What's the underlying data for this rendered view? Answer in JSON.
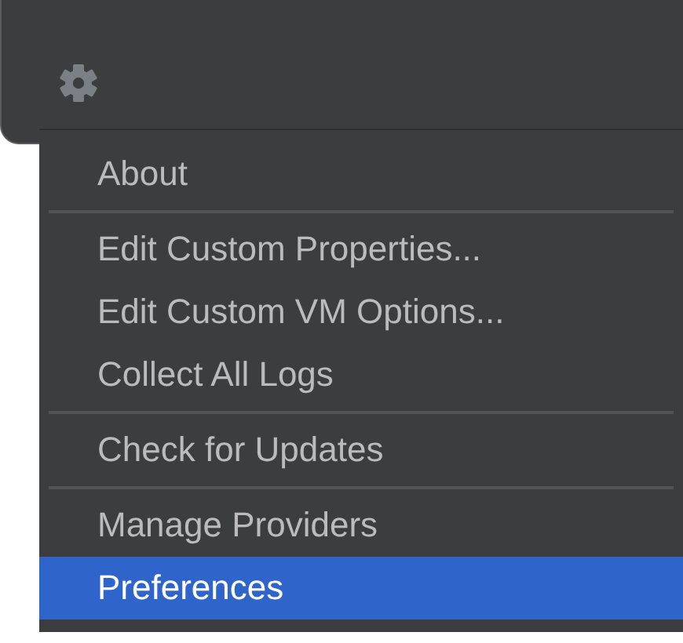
{
  "menu": {
    "groups": [
      {
        "items": [
          {
            "label": "About",
            "selected": false
          }
        ]
      },
      {
        "items": [
          {
            "label": "Edit Custom Properties...",
            "selected": false
          },
          {
            "label": "Edit Custom VM Options...",
            "selected": false
          },
          {
            "label": "Collect All Logs",
            "selected": false
          }
        ]
      },
      {
        "items": [
          {
            "label": "Check for Updates",
            "selected": false
          }
        ]
      },
      {
        "items": [
          {
            "label": "Manage Providers",
            "selected": false
          },
          {
            "label": "Preferences",
            "selected": true
          }
        ]
      }
    ]
  }
}
